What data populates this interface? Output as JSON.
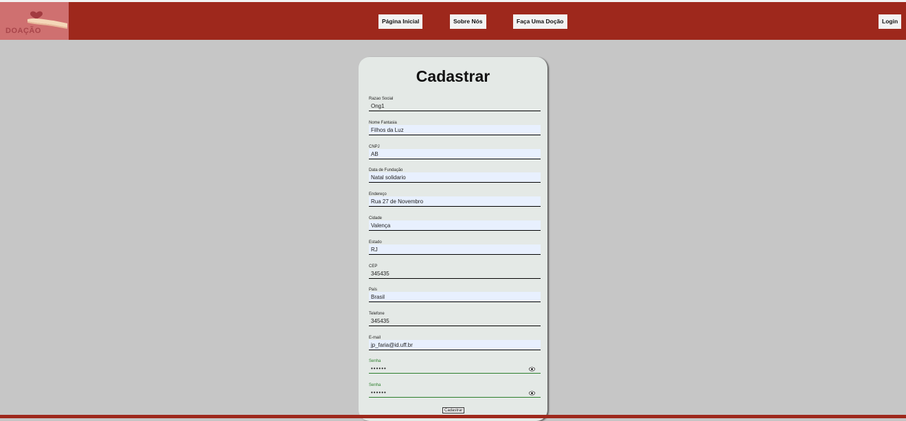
{
  "brand": {
    "logo_text": "DOAÇÃO"
  },
  "nav": {
    "home": "Página Inicial",
    "about": "Sobre Nós",
    "donate": "Faça Uma Doção",
    "login": "Login"
  },
  "form": {
    "title": "Cadastrar",
    "fields": [
      {
        "label": "Razao Social",
        "value": "Ong1"
      },
      {
        "label": "Nome Fantasia",
        "value": "Filhos da Luz"
      },
      {
        "label": "CNPJ",
        "value": "AB"
      },
      {
        "label": "Data de Fundação",
        "value": "Natal solidario"
      },
      {
        "label": "Endereço",
        "value": "Rua 27 de Novembro"
      },
      {
        "label": "Cidade",
        "value": "Valença"
      },
      {
        "label": "Estado",
        "value": "RJ"
      },
      {
        "label": "CEP",
        "value": "345435"
      },
      {
        "label": "País",
        "value": "Brasil"
      },
      {
        "label": "Telefone",
        "value": "345435"
      },
      {
        "label": "E-mail",
        "value": "jp_faria@id.uff.br"
      },
      {
        "label": "Senha",
        "value": "••••••"
      },
      {
        "label": "Senha",
        "value": "••••••"
      }
    ],
    "submit": "Cadastrar"
  },
  "colors": {
    "navbar": "#9e281c",
    "logo_bg": "#cf7070",
    "page_bg": "#c6c6c6",
    "card_bg": "#e4e9e6",
    "autofill_bg": "#e8f0fe",
    "password_accent": "#2a7d2a"
  },
  "icons": {
    "logo": "heart-hand-icon",
    "toggle_password": "eye-icon"
  }
}
